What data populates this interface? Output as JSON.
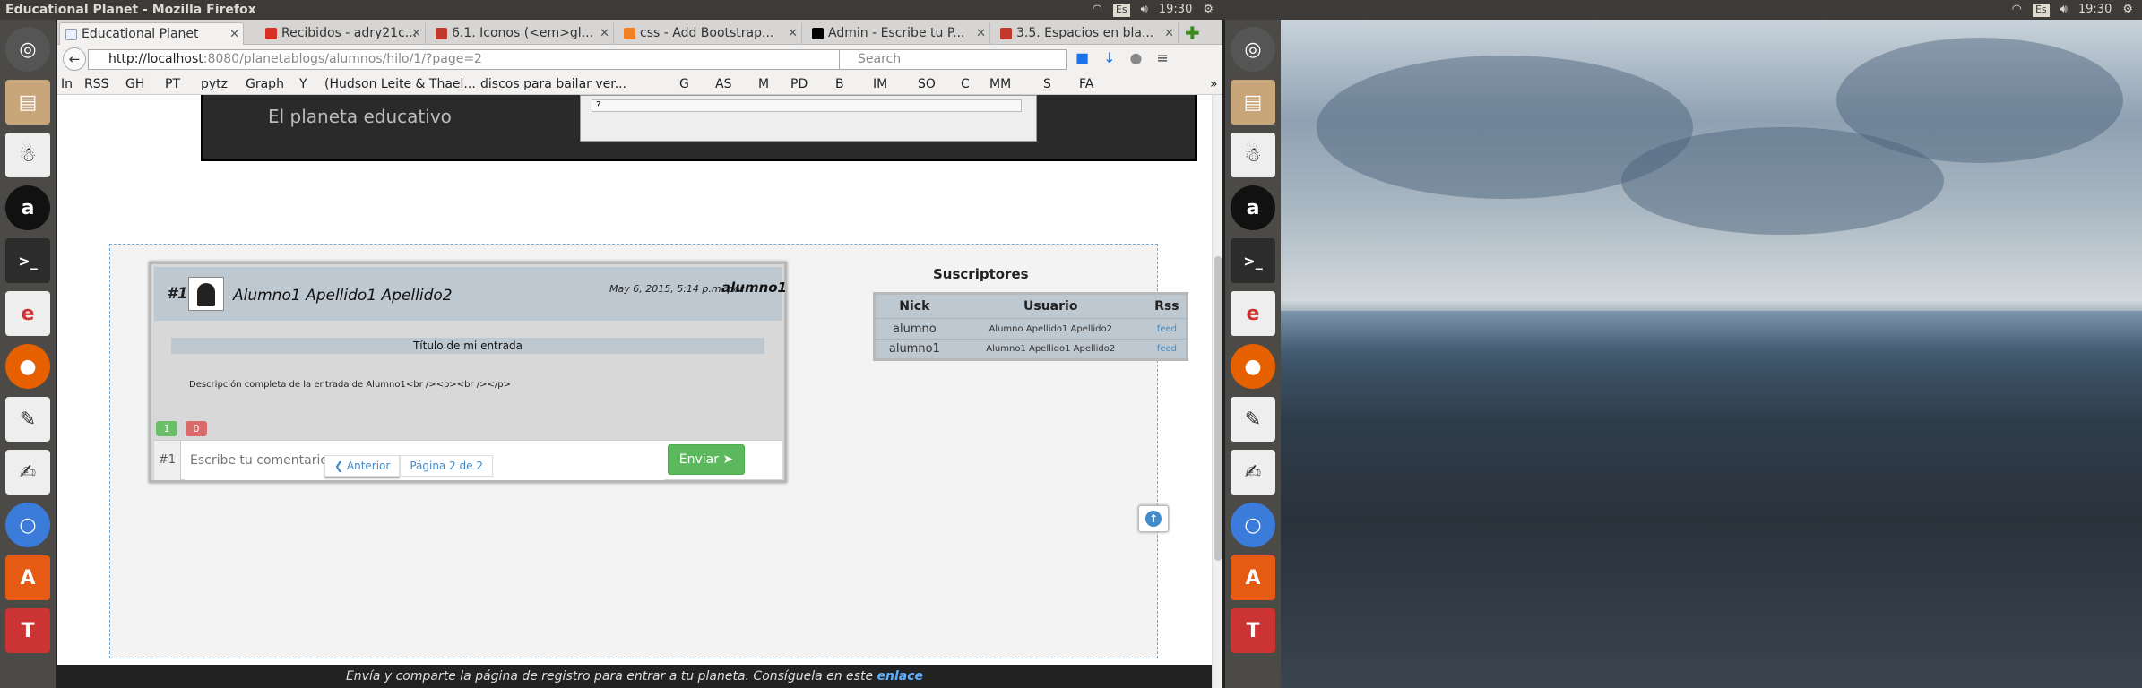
{
  "topbar": {
    "window_title": "Educational Planet - Mozilla Firefox",
    "keyboard_layout": "Es",
    "clock": "19:30"
  },
  "tabs": [
    {
      "label": "Educational Planet",
      "active": true,
      "color": "#e8f0ff"
    },
    {
      "label": "Recibidos - adry21c...",
      "active": false,
      "color": "#d93025"
    },
    {
      "label": "6.1. Iconos (<em>gl...",
      "active": false,
      "color": "#c0392b"
    },
    {
      "label": "css - Add Bootstrap...",
      "active": false,
      "color": "#f48024"
    },
    {
      "label": "Admin - Escribe tu P...",
      "active": false,
      "color": "#000000"
    },
    {
      "label": "3.5. Espacios en bla...",
      "active": false,
      "color": "#c0392b"
    }
  ],
  "navbar": {
    "url_host": "http://localhost",
    "url_rest": ":8080/planetablogs/alumnos/hilo/1/?page=2",
    "search_placeholder": "Search"
  },
  "bookmarks": [
    "In",
    "RSS",
    "GH",
    "PT",
    "pytz",
    "Graph",
    "Y",
    "(Hudson Leite & Thael...",
    "discos para bailar ver...",
    "G",
    "AS",
    "M",
    "PD",
    "B",
    "IM",
    "SO",
    "C",
    "MM",
    "S",
    "FA"
  ],
  "site": {
    "tagline": "El planeta educativo",
    "header_select_value": "?"
  },
  "post": {
    "number": "#1",
    "author_name": "Alumno1 Apellido1 Apellido2",
    "date": "May 6, 2015, 5:14 p.m. por",
    "author_user": "alumno1",
    "title": "Título de mi entrada",
    "description": "Descripción completa de la entrada de Alumno1<br /><p><br /></p>",
    "likes": "1",
    "dislikes": "0",
    "comment_prefix": "#1",
    "comment_placeholder": "Escribe tu comentario...",
    "send_label": "Enviar"
  },
  "subscribers": {
    "title": "Suscriptores",
    "columns": [
      "Nick",
      "Usuario",
      "Rss"
    ],
    "rows": [
      {
        "nick": "alumno",
        "usuario": "Alumno Apellido1 Apellido2",
        "rss": "feed"
      },
      {
        "nick": "alumno1",
        "usuario": "Alumno1 Apellido1 Apellido2",
        "rss": "feed"
      }
    ]
  },
  "pager": {
    "prev_label": "Anterior",
    "current": "Página 2 de 2"
  },
  "footer": {
    "text": "Envía y comparte la página de registro para entrar a tu planeta. Consíguela en este",
    "link": "enlace"
  }
}
